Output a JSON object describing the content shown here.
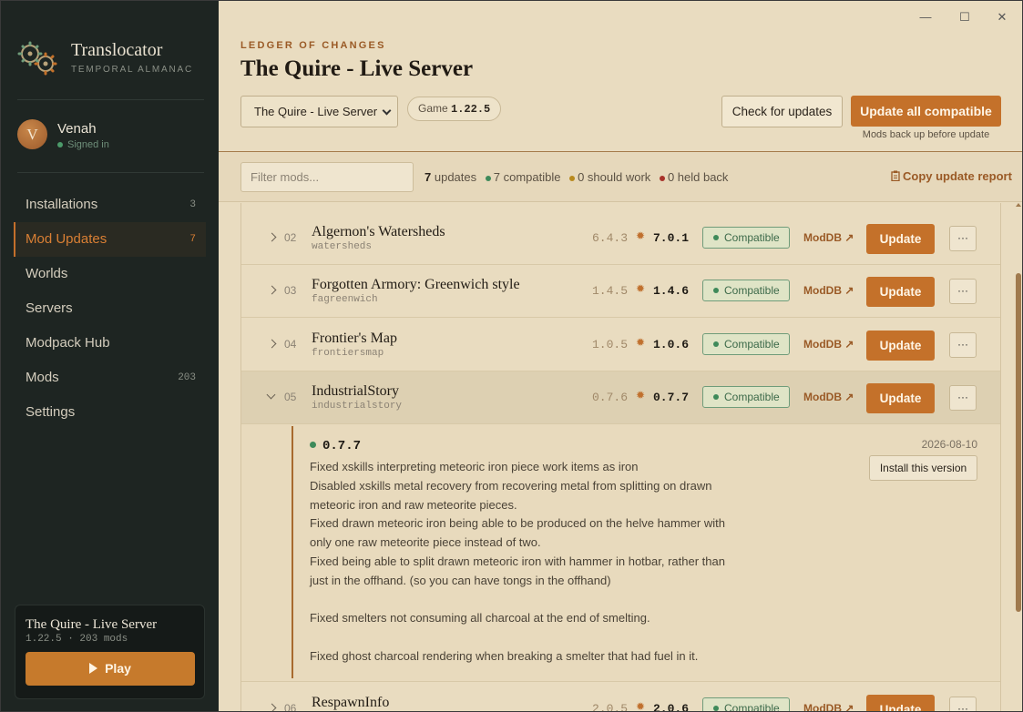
{
  "app": {
    "title": "Translocator",
    "subtitle": "TEMPORAL ALMANAC"
  },
  "user": {
    "initial": "V",
    "name": "Venah",
    "status": "Signed in"
  },
  "nav": [
    {
      "label": "Installations",
      "count": "3"
    },
    {
      "label": "Mod Updates",
      "count": "7",
      "active": true
    },
    {
      "label": "Worlds",
      "count": ""
    },
    {
      "label": "Servers",
      "count": ""
    },
    {
      "label": "Modpack Hub",
      "count": ""
    },
    {
      "label": "Mods",
      "count": "203"
    },
    {
      "label": "Settings",
      "count": ""
    }
  ],
  "server_card": {
    "title": "The Quire - Live Server",
    "meta": "1.22.5 · 203 mods",
    "play_label": "Play"
  },
  "window_controls": {
    "minimize": "—",
    "maximize": "☐",
    "close": "✕"
  },
  "header": {
    "eyebrow": "LEDGER OF CHANGES",
    "title": "The Quire - Live Server",
    "server_select": "The Quire - Live Server",
    "game_label": "Game",
    "game_version": "1.22.5",
    "check_label": "Check for updates",
    "update_all_label": "Update all compatible",
    "update_note": "Mods back up before update"
  },
  "toolbar": {
    "filter_placeholder": "Filter mods...",
    "updates_count": "7",
    "updates_label": "updates",
    "compatible": "7 compatible",
    "should_work": "0 should work",
    "held_back": "0 held back",
    "copy_report": "Copy update report"
  },
  "mods": [
    {
      "index": "02",
      "name": "Algernon's Watersheds",
      "id": "watersheds",
      "old": "6.4.3",
      "new": "7.0.1",
      "status": "Compatible",
      "link": "ModDB ↗",
      "update": "Update",
      "more": "···"
    },
    {
      "index": "03",
      "name": "Forgotten Armory: Greenwich style",
      "id": "fagreenwich",
      "old": "1.4.5",
      "new": "1.4.6",
      "status": "Compatible",
      "link": "ModDB ↗",
      "update": "Update",
      "more": "···"
    },
    {
      "index": "04",
      "name": "Frontier's Map",
      "id": "frontiersmap",
      "old": "1.0.5",
      "new": "1.0.6",
      "status": "Compatible",
      "link": "ModDB ↗",
      "update": "Update",
      "more": "···"
    },
    {
      "index": "05",
      "name": "IndustrialStory",
      "id": "industrialstory",
      "old": "0.7.6",
      "new": "0.7.7",
      "status": "Compatible",
      "link": "ModDB ↗",
      "update": "Update",
      "more": "···"
    },
    {
      "index": "06",
      "name": "RespawnInfo",
      "id": "",
      "old": "2.0.5",
      "new": "2.0.6",
      "status": "Compatible",
      "link": "ModDB ↗",
      "update": "Update",
      "more": "···"
    }
  ],
  "detail": {
    "version": "0.7.7",
    "date": "2026-08-10",
    "install_label": "Install this version",
    "notes_block1": "Fixed xskills interpreting meteoric iron piece work items as iron\nDisabled xskills metal recovery from recovering metal from splitting on drawn meteoric iron and raw meteorite pieces.\nFixed drawn meteoric iron being able to be produced on the helve hammer with only one raw meteorite piece instead of two.\nFixed being able to split drawn meteoric iron with hammer in hotbar, rather than just in the offhand. (so you can have tongs in the offhand)",
    "notes_block2": "Fixed smelters not consuming all charcoal at the end of smelting.",
    "notes_block3": "Fixed ghost charcoal rendering when breaking a smelter that had fuel in it."
  },
  "colors": {
    "accent": "#c4712a",
    "sidebar": "#1e2522",
    "background": "#e9dcc0",
    "compatible": "#3e8a5a"
  }
}
